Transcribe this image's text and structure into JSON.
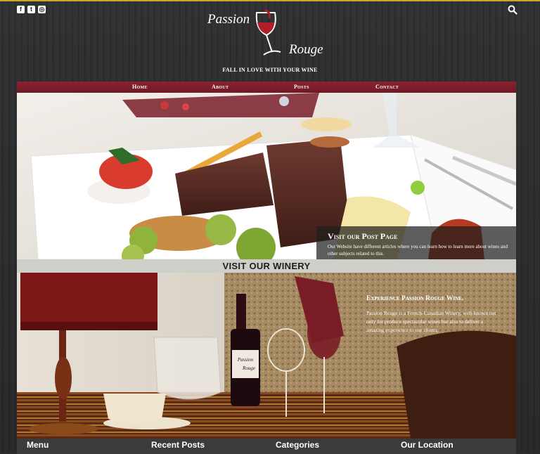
{
  "header": {
    "logo_line1": "Passion",
    "logo_line2": "Rouge",
    "tagline": "FALL IN LOVE WITH YOUR WINE",
    "social": [
      {
        "icon": "facebook-icon",
        "glyph": "f"
      },
      {
        "icon": "twitter-icon",
        "glyph": "t"
      },
      {
        "icon": "instagram-icon",
        "glyph": "◎"
      }
    ],
    "search_icon": "search-icon"
  },
  "nav": {
    "items": [
      "Home",
      "About",
      "Posts",
      "Contact"
    ]
  },
  "hero": {
    "caption_title": "Visit our Post Page",
    "caption_text": "Our Website have different articles where you can learn how to learn more about wines and other subjects related to this."
  },
  "winery": {
    "banner": "VISIT OUR WINERY",
    "title": "Experience Passion Rouge Wine.",
    "text": "Passion Rouge is a French-Canadian Winery, well-known not only for produce spectacular wines but also to deliver a amazing experience to our clients.",
    "bottle_label_line1": "Passion",
    "bottle_label_line2": "Rouge"
  },
  "footer": {
    "menu": "Menu",
    "recent_posts": "Recent Posts",
    "categories": "Categories",
    "location": "Our Location"
  },
  "colors": {
    "nav_bg": "#7c1f2b",
    "page_bg": "#2a2b2d",
    "accent_gold": "#c9a227"
  }
}
